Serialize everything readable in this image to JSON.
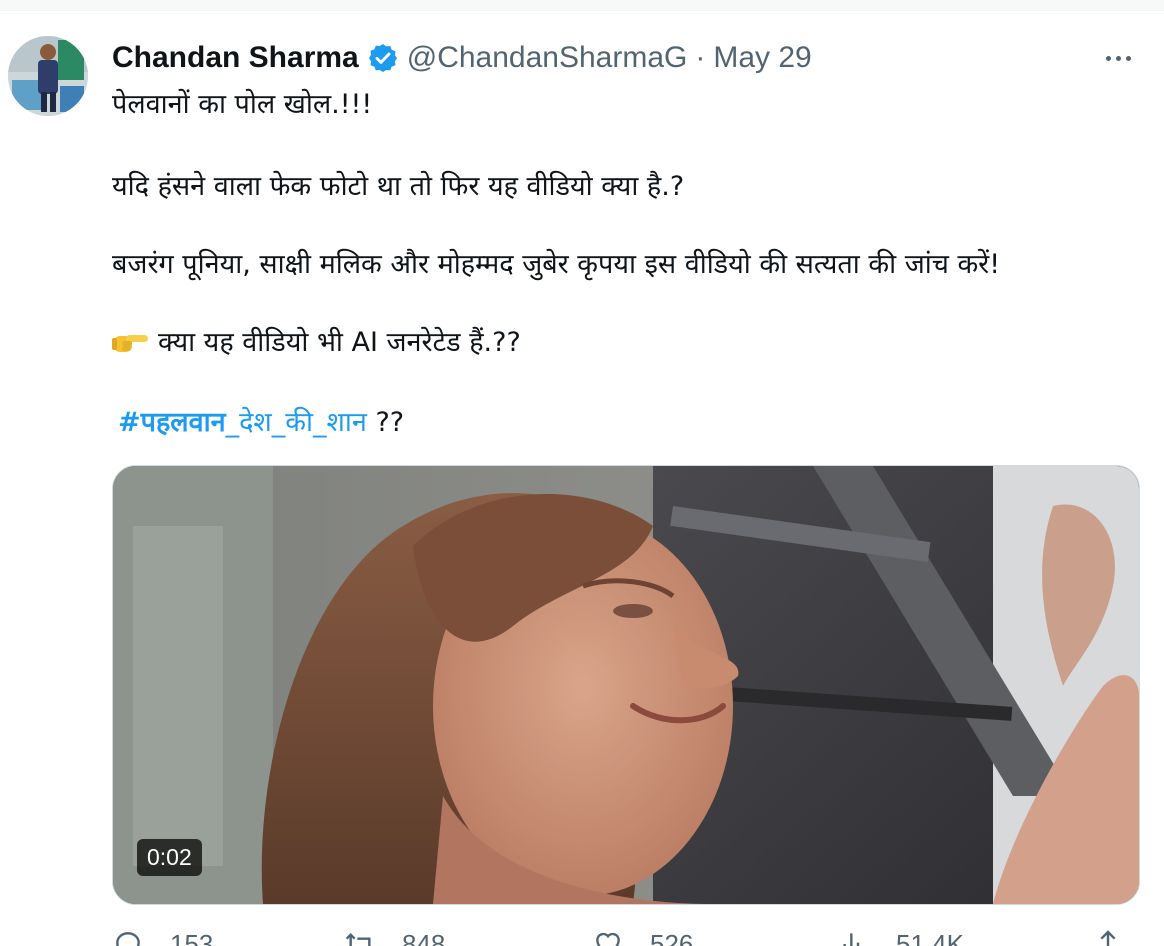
{
  "tweet": {
    "author_name": "Chandan Sharma",
    "handle": "@ChandanSharmaG",
    "separator": "·",
    "date": "May 29",
    "lines": [
      "पेलवानों का पोल खोल.!!!",
      "यदि हंसने वाला फेक फोटो था तो फिर यह वीडियो क्या है.?",
      "बजरंग पूनिया, साक्षी मलिक और मोहम्मद जुबेर कृपया इस वीडियो की सत्यता की जांच करें!",
      "क्या यह वीडियो भी AI जनरेटेड हैं.??"
    ],
    "hashtag_bold": "#पहलवान",
    "hashtag_rest": "_देश_की_शान",
    "after_hashtag": " ??",
    "video_timestamp": "0:02"
  },
  "actions": {
    "reply_count": "153",
    "retweet_count": "848",
    "like_count": "526",
    "views_count": "51.4K"
  },
  "icons": {
    "verified": "verified-badge-icon",
    "more": "more-icon",
    "pointing": "pointing-hand-emoji",
    "reply": "reply-icon",
    "retweet": "retweet-icon",
    "like": "heart-icon",
    "views": "views-icon",
    "share": "share-icon"
  },
  "colors": {
    "accent": "#1d9bf0",
    "secondary_text": "#536471",
    "primary_text": "#0f1419"
  }
}
